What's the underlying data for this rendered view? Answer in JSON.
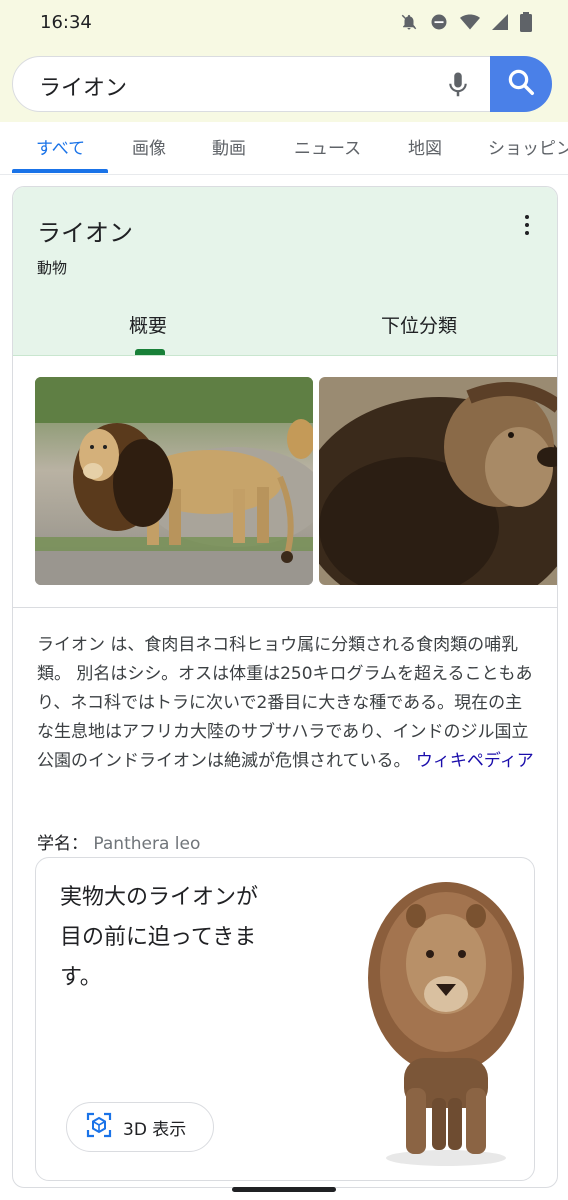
{
  "status": {
    "time": "16:34"
  },
  "search": {
    "query": "ライオン"
  },
  "tabs": [
    "すべて",
    "画像",
    "動画",
    "ニュース",
    "地図",
    "ショッピン"
  ],
  "knowledge": {
    "title": "ライオン",
    "subtitle": "動物",
    "tabs": [
      "概要",
      "下位分類"
    ],
    "description": "ライオン は、食肉目ネコ科ヒョウ属に分類される食肉類の哺乳類。 別名はシシ。オスは体重は250キログラムを超えることもあり、ネコ科ではトラに次いで2番目に大きな種である。現在の主な生息地はアフリカ大陸のサブサハラであり、インドのジル国立公園のインドライオンは絶滅が危惧されている。",
    "source_link": "ウィキペディア",
    "sci_label": "学名：",
    "sci_value": "Panthera leo",
    "ar_text": "実物大のライオンが目の前に迫ってきます。",
    "btn_3d": "3D 表示"
  },
  "colors": {
    "accent": "#1a73e8",
    "header_bg": "#e6f4ea",
    "search_btn": "#4a80e8",
    "indicator": "#188038"
  },
  "icons": [
    "mute-icon",
    "dnd-icon",
    "wifi-icon",
    "signal-icon",
    "battery-icon",
    "mic-icon",
    "search-icon",
    "more-vert-icon",
    "ar-cube-icon"
  ]
}
